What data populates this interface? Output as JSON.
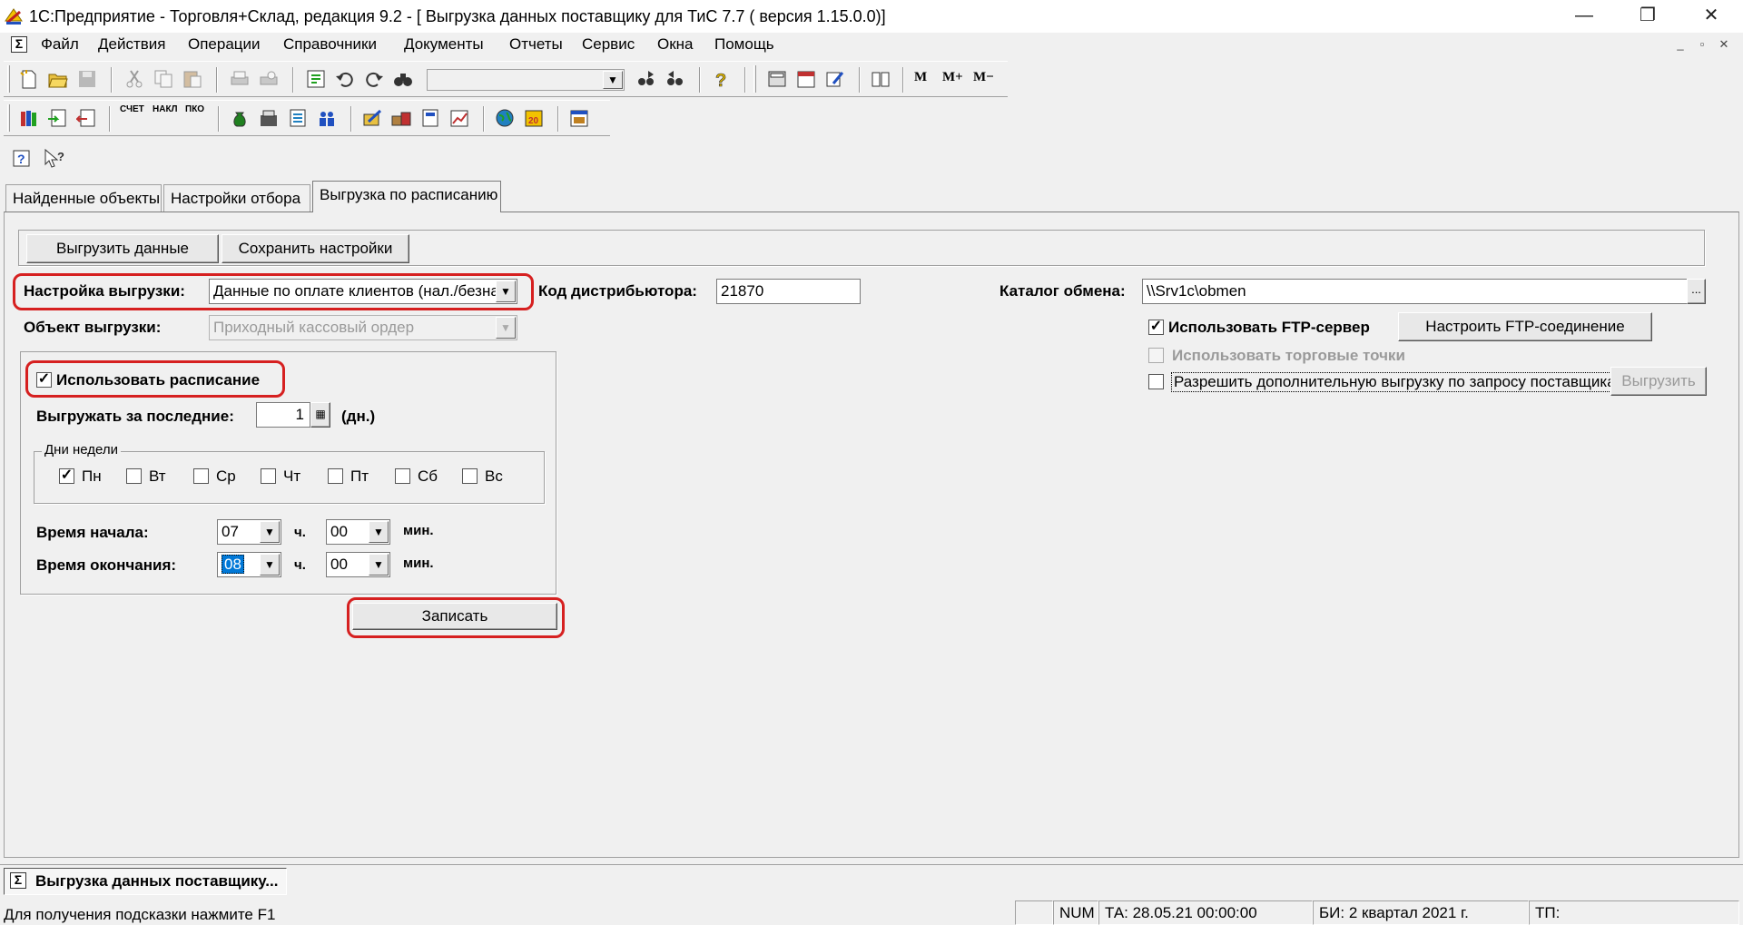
{
  "window": {
    "title": "1С:Предприятие - Торговля+Склад, редакция 9.2 - [ Выгрузка данных поставщику для ТиС 7.7 ( версия 1.15.0.0)]",
    "buttons": {
      "minimize": "—",
      "restore": "❐",
      "close": "✕"
    }
  },
  "menu": {
    "items": [
      "Файл",
      "Действия",
      "Операции",
      "Справочники",
      "Документы",
      "Отчеты",
      "Сервис",
      "Окна",
      "Помощь"
    ],
    "mdi": {
      "minimize": "_",
      "restore": "▫",
      "close": "✕"
    }
  },
  "toolbar": {
    "memory": {
      "m": "M",
      "mplus": "M+",
      "mminus": "M−"
    },
    "small_labels": {
      "schet": "СЧЕТ",
      "nakl": "НАКЛ",
      "pko": "ПКО"
    }
  },
  "tabs": [
    "Найденные объекты",
    "Настройки отбора",
    "Выгрузка по расписанию"
  ],
  "form": {
    "buttons": {
      "export_data": "Выгрузить данные",
      "save_settings": "Сохранить настройки"
    },
    "export_setting": {
      "label": "Настройка выгрузки:",
      "value": "Данные по оплате клиентов (нал./безна"
    },
    "export_object": {
      "label": "Объект выгрузки:",
      "value": "Приходный кассовый ордер"
    },
    "distributor_code": {
      "label": "Код дистрибьютора:",
      "value": "21870"
    },
    "exchange_dir": {
      "label": "Каталог обмена:",
      "value": "\\\\Srv1c\\obmen",
      "browse": "..."
    },
    "ftp": {
      "use_label": "Использовать FTP-сервер",
      "checked": true,
      "configure_button": "Настроить FTP-соединение"
    },
    "use_trade_points": {
      "label": "Использовать торговые точки",
      "checked": false,
      "enabled": false
    },
    "extra_export": {
      "label": "Разрешить дополнительную выгрузку по запросу поставщика",
      "checked": false,
      "button": "Выгрузить"
    },
    "schedule": {
      "use_label": "Использовать расписание",
      "checked": true,
      "last_days_label": "Выгружать за последние:",
      "last_days_value": "1",
      "days_unit": "(дн.)",
      "weekdays_title": "Дни недели",
      "weekdays": [
        {
          "label": "Пн",
          "checked": true
        },
        {
          "label": "Вт",
          "checked": false
        },
        {
          "label": "Ср",
          "checked": false
        },
        {
          "label": "Чт",
          "checked": false
        },
        {
          "label": "Пт",
          "checked": false
        },
        {
          "label": "Сб",
          "checked": false
        },
        {
          "label": "Вс",
          "checked": false
        }
      ],
      "start_label": "Время начала:",
      "end_label": "Время окончания:",
      "start_hour": "07",
      "start_min": "00",
      "end_hour": "08",
      "end_min": "00",
      "hour_unit": "ч.",
      "min_unit": "мин."
    },
    "write_button": "Записать"
  },
  "taskbar": {
    "item": "Выгрузка данных поставщику..."
  },
  "status": {
    "hint": "Для получения подсказки нажмите F1",
    "num": "NUM",
    "ta": "ТА: 28.05.21  00:00:00",
    "bi": "БИ: 2 квартал 2021 г.",
    "tp": "ТП:"
  },
  "colors": {
    "highlight": "#d62020",
    "selection": "#0078d7"
  }
}
